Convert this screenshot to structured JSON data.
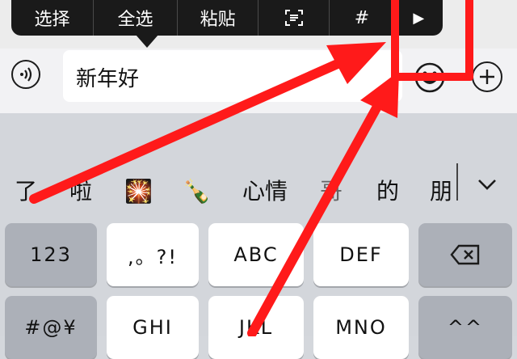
{
  "context_menu": {
    "items": [
      {
        "label": "选择"
      },
      {
        "label": "全选"
      },
      {
        "label": "粘贴"
      },
      {
        "label": "",
        "icon": "scan-text-icon"
      },
      {
        "label": "#"
      },
      {
        "label": "▶"
      }
    ]
  },
  "input": {
    "value": "新年好"
  },
  "candidates": [
    "了",
    "啦",
    "🎇",
    "🍾",
    "心情",
    "哥",
    "的",
    "朋"
  ],
  "keys": {
    "row1": [
      "123",
      ",。?!",
      "ABC",
      "DEF"
    ],
    "row2": [
      "#@¥",
      "GHI",
      "JKL",
      "MNO",
      "^^"
    ]
  },
  "colors": {
    "menu_bg": "#1a1a1a",
    "annotation_red": "#ff1a1a",
    "keyboard_bg": "#d3d6db",
    "key_light": "#ffffff",
    "key_dark": "#acb0b8"
  },
  "icons": {
    "voice": "voice-input-icon",
    "emoji": "emoji-face-icon",
    "plus": "plus-circle-icon",
    "backspace": "backspace-icon",
    "expand": "chevron-down-icon"
  }
}
